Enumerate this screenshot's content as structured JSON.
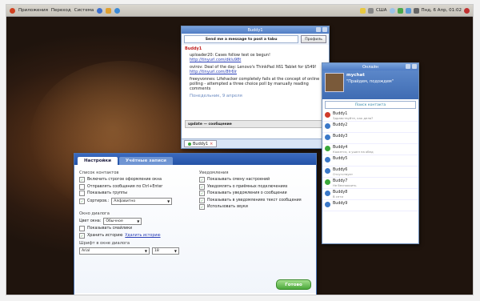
{
  "topbar": {
    "menu": [
      "Приложения",
      "Переход",
      "Система"
    ],
    "weather": "США",
    "clock": "Пнд, 6 Апр, 01:02"
  },
  "chat": {
    "title": "Buddy1",
    "to_field": "Send me a message to post a tabu",
    "to_button": "Профиль",
    "contact_nick": "Buddy1",
    "messages": [
      {
        "text": "uploader20: Cases follow test ox begun!",
        "link": "http://tinyurl.com/dklu98t"
      },
      {
        "text": "ovirov: Deal of the day: Lenovo's ThinkPad X61 Tablet for $549!",
        "link": "http://tinyurl.com/8fr6lr"
      },
      {
        "text": "freeyvonnes: Lifehacker completely fails at the concept of online polling - attempted a three choice poll by manually reading comments",
        "link": ""
      }
    ],
    "time_label": "Понедельник, 9 апреля",
    "input_value": "update — сообщение",
    "tab_label": "Buddy1"
  },
  "contacts": {
    "title": "Онлайн",
    "my_name": "mychat",
    "my_status": "\"Прайдем, подождем\"",
    "search_placeholder": "Поиск контакта",
    "buddies": [
      {
        "name": "Buddy1",
        "status": "Здравствуйте, как дела?",
        "color": "#d03a2a"
      },
      {
        "name": "Buddy2",
        "status": "",
        "color": "#3a78c8"
      },
      {
        "name": "Buddy3",
        "status": "",
        "color": "#3a78c8"
      },
      {
        "name": "Buddy4",
        "status": "Кажется, я ушел на обед",
        "color": "#3aa83a"
      },
      {
        "name": "Buddy5",
        "status": "",
        "color": "#3a78c8"
      },
      {
        "name": "Buddy6",
        "status": "Отсутствует",
        "color": "#3a78c8"
      },
      {
        "name": "Buddy7",
        "status": "Не беспокоить",
        "color": "#3aa83a"
      },
      {
        "name": "Buddy8",
        "status": "В сети",
        "color": "#3a78c8"
      },
      {
        "name": "Buddy9",
        "status": "",
        "color": "#3a78c8"
      }
    ]
  },
  "settings": {
    "tab_active": "Настройки",
    "tab_inactive": "Учётные записи",
    "sec_messages": "Список контактов",
    "left_opts": [
      {
        "label": "Включить строгое оформление окна",
        "checked": true
      },
      {
        "label": "Отправлять сообщения по Ctrl+Enter",
        "checked": false
      },
      {
        "label": "Показывать группы",
        "checked": false
      }
    ],
    "sort_label": "Сортиров.:",
    "sort_value": "Алфавитно",
    "sec_notifications": "Уведомления",
    "right_opts": [
      {
        "label": "Показывать смену настроений",
        "checked": true
      },
      {
        "label": "Уведомлять о приёмных подключениях",
        "checked": true
      },
      {
        "label": "Показывать уведомления о сообщении",
        "checked": true
      },
      {
        "label": "Показывать в уведомлениях текст сообщения",
        "checked": true
      },
      {
        "label": "Использовать звуки",
        "checked": true
      }
    ],
    "sec_chat": "Окно диалога",
    "color_label": "Цвет окна:",
    "color_value": "Обычное",
    "chat_opts": [
      {
        "label": "Показывать смайлики",
        "checked": false
      },
      {
        "label": "Хранить историю",
        "checked": true
      }
    ],
    "history_link": "Удалить историю",
    "font_label": "Шрифт в окне диалога",
    "font_value": "Arial",
    "font_size": "18",
    "apply_label": "Готово"
  }
}
